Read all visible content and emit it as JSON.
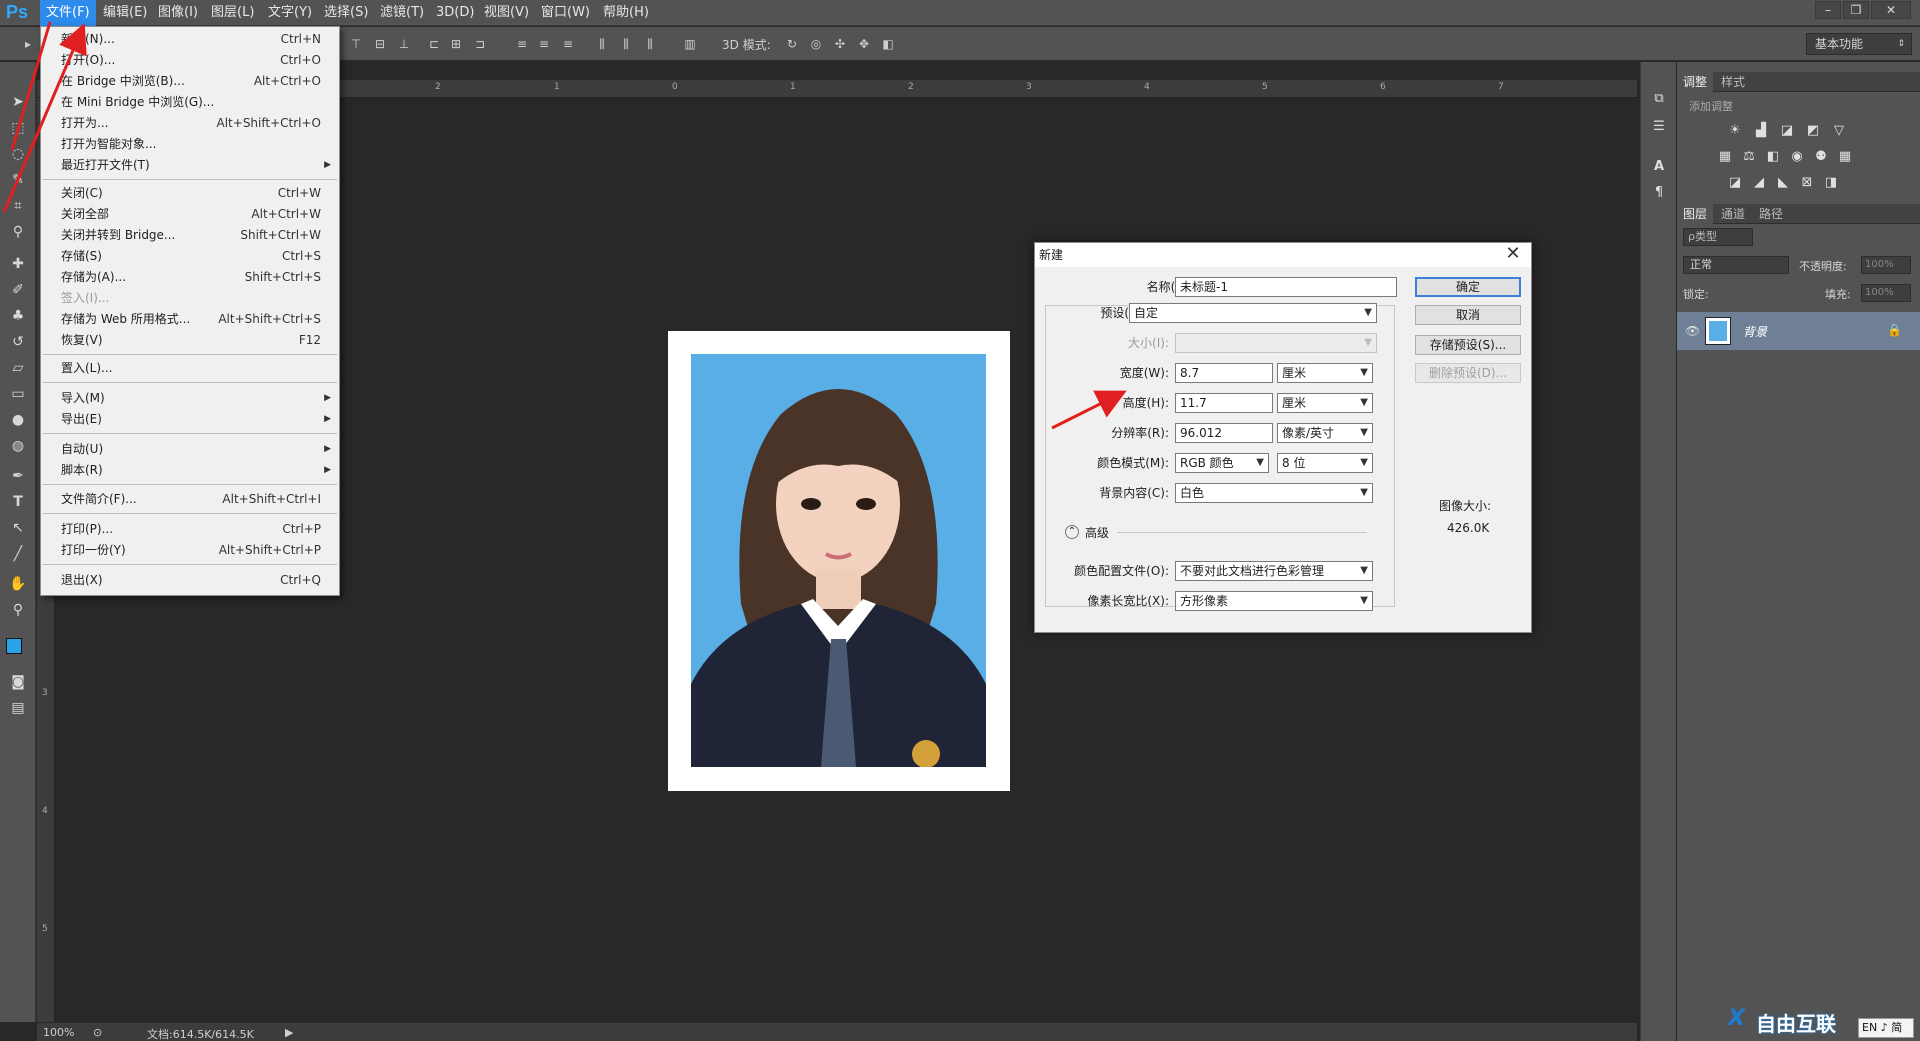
{
  "app": {
    "logo": "Ps",
    "accent": "#31a8ff",
    "menu_highlight": "#2d8ceb"
  },
  "menubar": {
    "items": [
      "文件(F)",
      "编辑(E)",
      "图像(I)",
      "图层(L)",
      "文字(Y)",
      "选择(S)",
      "滤镜(T)",
      "3D(D)",
      "视图(V)",
      "窗口(W)",
      "帮助(H)"
    ],
    "active": "文件(F)"
  },
  "window_controls": [
    "minimize-icon",
    "restore-icon",
    "close-icon"
  ],
  "optionsbar": {
    "mode_3d_label": "3D 模式:",
    "workspace": "基本功能"
  },
  "file_menu": {
    "items": [
      {
        "label": "新建(N)...",
        "shortcut": "Ctrl+N"
      },
      {
        "label": "打开(O)...",
        "shortcut": "Ctrl+O"
      },
      {
        "label": "在 Bridge 中浏览(B)...",
        "shortcut": "Alt+Ctrl+O"
      },
      {
        "label": "在 Mini Bridge 中浏览(G)...",
        "shortcut": ""
      },
      {
        "label": "打开为...",
        "shortcut": "Alt+Shift+Ctrl+O"
      },
      {
        "label": "打开为智能对象...",
        "shortcut": ""
      },
      {
        "label": "最近打开文件(T)",
        "shortcut": ""
      },
      {
        "label": "关闭(C)",
        "shortcut": "Ctrl+W"
      },
      {
        "label": "关闭全部",
        "shortcut": "Alt+Ctrl+W"
      },
      {
        "label": "关闭并转到 Bridge...",
        "shortcut": "Shift+Ctrl+W"
      },
      {
        "label": "存储(S)",
        "shortcut": "Ctrl+S"
      },
      {
        "label": "存储为(A)...",
        "shortcut": "Shift+Ctrl+S"
      },
      {
        "label": "签入(I)...",
        "shortcut": ""
      },
      {
        "label": "存储为 Web 所用格式...",
        "shortcut": "Alt+Shift+Ctrl+S"
      },
      {
        "label": "恢复(V)",
        "shortcut": "F12"
      },
      {
        "label": "置入(L)...",
        "shortcut": ""
      },
      {
        "label": "导入(M)",
        "shortcut": ""
      },
      {
        "label": "导出(E)",
        "shortcut": ""
      },
      {
        "label": "自动(U)",
        "shortcut": ""
      },
      {
        "label": "脚本(R)",
        "shortcut": ""
      },
      {
        "label": "文件简介(F)...",
        "shortcut": "Alt+Shift+Ctrl+I"
      },
      {
        "label": "打印(P)...",
        "shortcut": "Ctrl+P"
      },
      {
        "label": "打印一份(Y)",
        "shortcut": "Alt+Shift+Ctrl+P"
      },
      {
        "label": "退出(X)",
        "shortcut": "Ctrl+Q"
      }
    ]
  },
  "ruler": {
    "top_ticks": [
      "2",
      "1",
      "0",
      "1",
      "2",
      "3",
      "4",
      "5",
      "6",
      "7"
    ],
    "left_ticks": [
      "3",
      "4",
      "5"
    ]
  },
  "status": {
    "zoom": "100%",
    "doc_info": "文档:614.5K/614.5K"
  },
  "dialog": {
    "title": "新建",
    "name_label": "名称(N):",
    "name_value": "未标题-1",
    "preset_label": "预设(P):",
    "preset_value": "自定",
    "size_label": "大小(I):",
    "size_value": "",
    "width_label": "宽度(W):",
    "width_value": "8.7",
    "width_unit": "厘米",
    "height_label": "高度(H):",
    "height_value": "11.7",
    "height_unit": "厘米",
    "resolution_label": "分辨率(R):",
    "resolution_value": "96.012",
    "resolution_unit": "像素/英寸",
    "color_mode_label": "颜色模式(M):",
    "color_mode_value": "RGB 颜色",
    "bit_depth": "8 位",
    "bg_label": "背景内容(C):",
    "bg_value": "白色",
    "advanced_label": "高级",
    "profile_label": "颜色配置文件(O):",
    "profile_value": "不要对此文档进行色彩管理",
    "aspect_label": "像素长宽比(X):",
    "aspect_value": "方形像素",
    "ok": "确定",
    "cancel": "取消",
    "save_preset": "存储预设(S)...",
    "delete_preset": "删除预设(D)...",
    "image_size_label": "图像大小:",
    "image_size_value": "426.0K"
  },
  "right_panel": {
    "adjust_tabs": [
      "调整",
      "样式"
    ],
    "add_adjust": "添加调整",
    "layers_tabs": [
      "图层",
      "通道",
      "路径"
    ],
    "kind_filter": "ρ类型",
    "blend_mode": "正常",
    "opacity_label": "不透明度:",
    "opacity_value": "100%",
    "lock_label": "锁定:",
    "fill_label": "填充:",
    "fill_value": "100%",
    "layer_name": "背景"
  },
  "taskbar": {
    "ime": "EN",
    "ime2": "♪ 简"
  },
  "watermark": {
    "text": "自由互联"
  }
}
